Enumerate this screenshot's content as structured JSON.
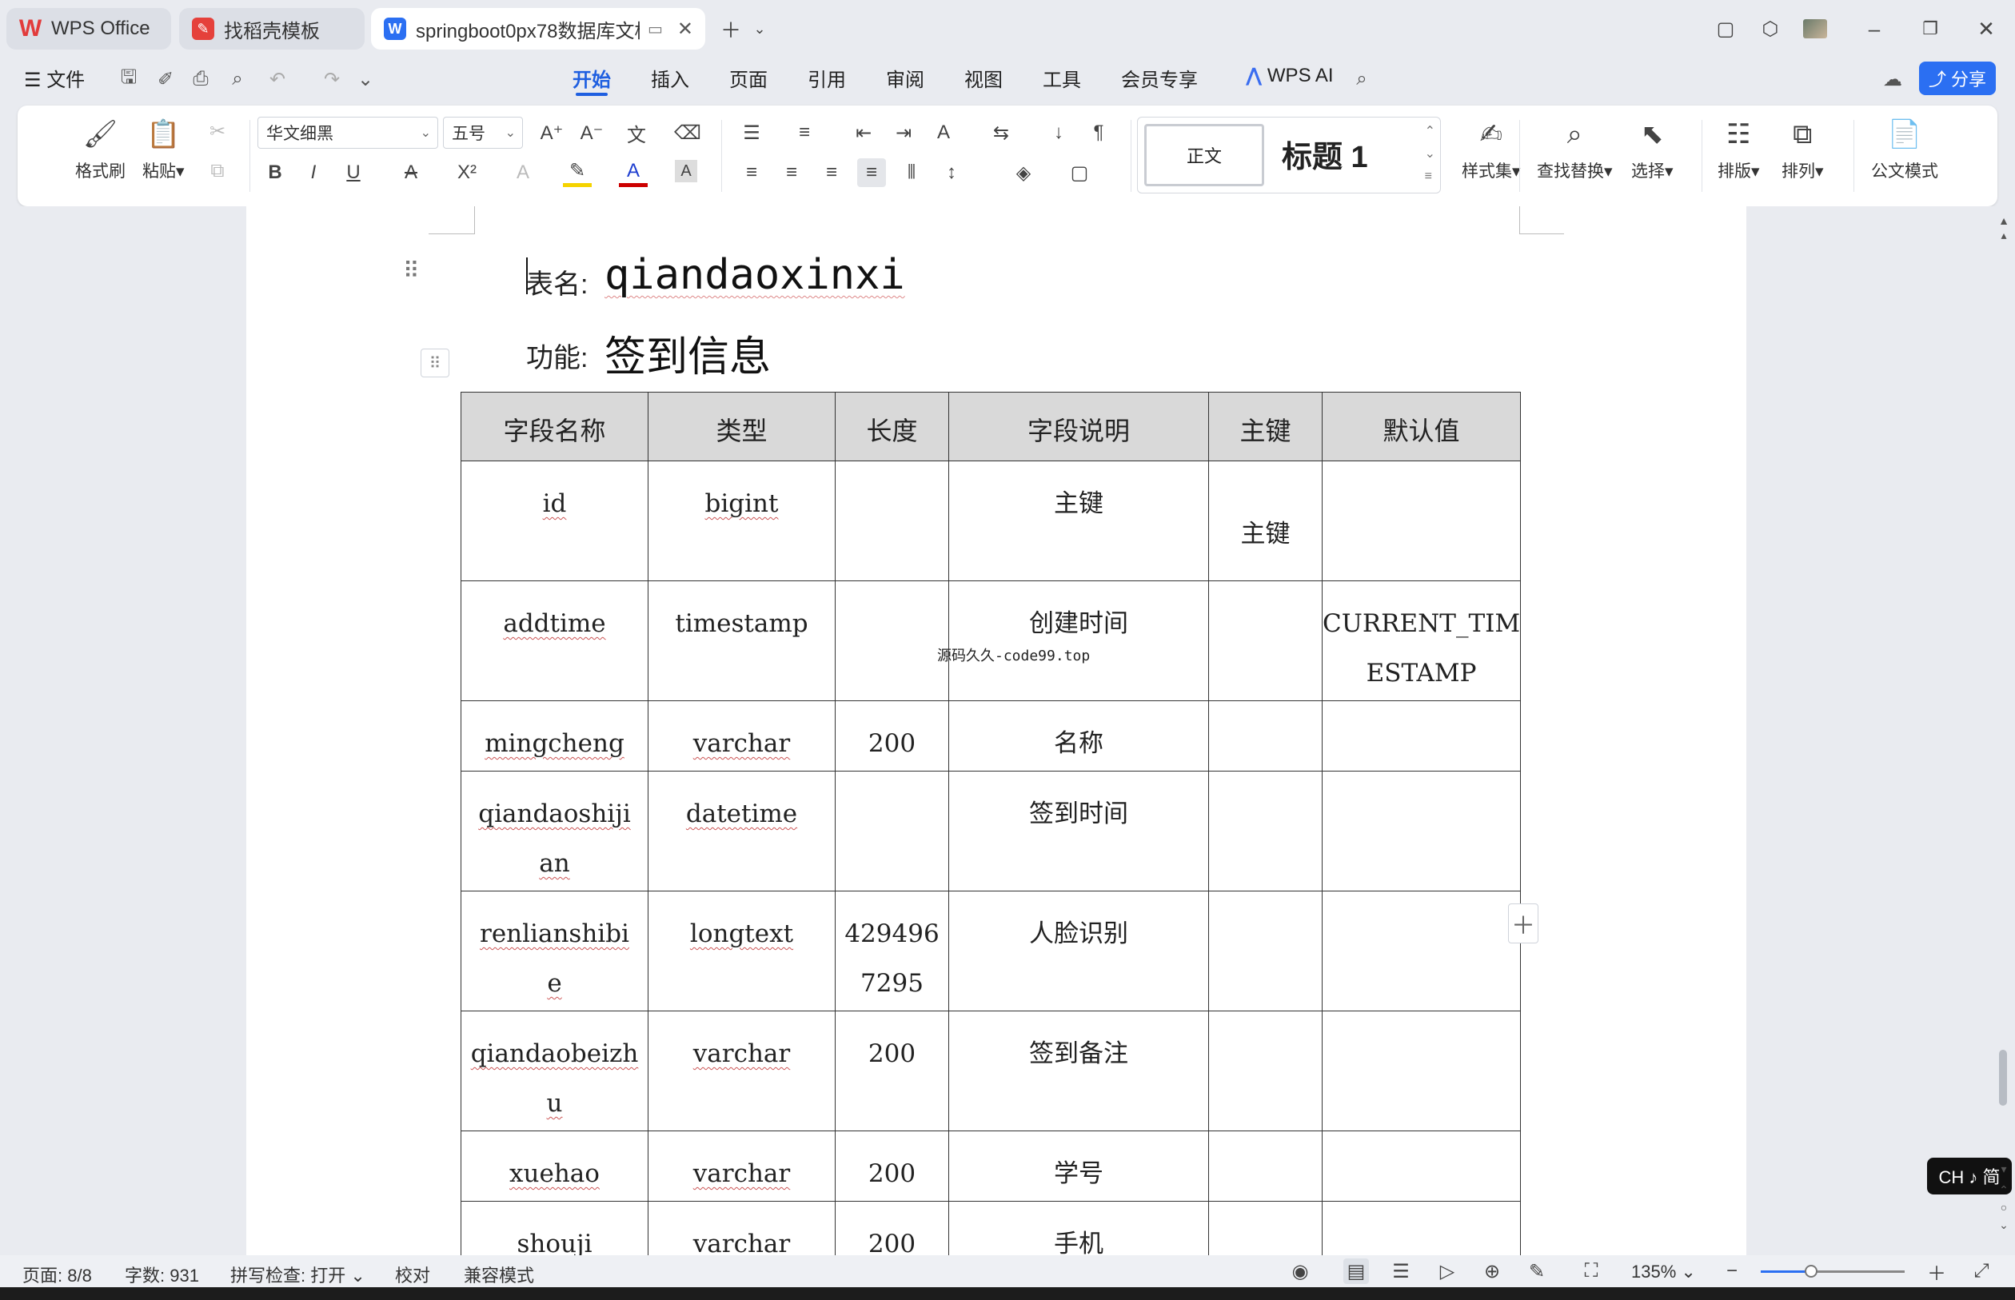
{
  "tabs": [
    {
      "label": "WPS Office",
      "icon": "wps-logo-icon",
      "color": "#e23b3b"
    },
    {
      "label": "找稻壳模板",
      "icon": "docer-icon",
      "color": "#e5413b"
    },
    {
      "label": "springboot0px78数据库文档",
      "icon": "word-doc-icon",
      "color": "#2b6ff2"
    }
  ],
  "menu": {
    "file": "文件",
    "items": [
      "开始",
      "插入",
      "页面",
      "引用",
      "审阅",
      "视图",
      "工具",
      "会员专享"
    ],
    "active_index": 0,
    "wps_ai": "WPS AI",
    "share": "分享"
  },
  "ribbon": {
    "format_painter": "格式刷",
    "paste": "粘贴",
    "font_name": "华文细黑",
    "font_size": "五号",
    "style_normal": "正文",
    "style_heading": "标题 1",
    "style_set": "样式集",
    "find_replace": "查找替换",
    "select": "选择",
    "layout": "排版",
    "arrange": "排列",
    "official_mode": "公文模式"
  },
  "document": {
    "table_label": "表名:",
    "table_name": "qiandaoxinxi",
    "func_label": "功能:",
    "func_name": "签到信息",
    "watermark": "源码久久-code99.top",
    "columns": [
      "字段名称",
      "类型",
      "长度",
      "字段说明",
      "主键",
      "默认值"
    ],
    "rows": [
      {
        "name": [
          "id"
        ],
        "type": "bigint",
        "length": [],
        "desc": "主键",
        "pk": "主键",
        "default": []
      },
      {
        "name": [
          "addtime"
        ],
        "type": "timestamp",
        "length": [],
        "desc": "创建时间",
        "pk": "",
        "default": [
          "CURRENT_TIM",
          "ESTAMP"
        ]
      },
      {
        "name": [
          "mingcheng"
        ],
        "type": "varchar",
        "length": [
          "200"
        ],
        "desc": "名称",
        "pk": "",
        "default": []
      },
      {
        "name": [
          "qiandaoshiji",
          "an"
        ],
        "type": "datetime",
        "length": [],
        "desc": "签到时间",
        "pk": "",
        "default": []
      },
      {
        "name": [
          "renlianshibi",
          "e"
        ],
        "type": "longtext",
        "length": [
          "429496",
          "7295"
        ],
        "desc": "人脸识别",
        "pk": "",
        "default": []
      },
      {
        "name": [
          "qiandaobeizh",
          "u"
        ],
        "type": "varchar",
        "length": [
          "200"
        ],
        "desc": "签到备注",
        "pk": "",
        "default": []
      },
      {
        "name": [
          "xuehao"
        ],
        "type": "varchar",
        "length": [
          "200"
        ],
        "desc": "学号",
        "pk": "",
        "default": []
      },
      {
        "name": [
          "shouji"
        ],
        "type": "varchar",
        "length": [
          "200"
        ],
        "desc": "手机",
        "pk": "",
        "default": []
      }
    ]
  },
  "ime": "CH ♪ 简",
  "status": {
    "page": "页面: 8/8",
    "words": "字数: 931",
    "spell": "拼写检查: 打开",
    "proof": "校对",
    "compat": "兼容模式",
    "zoom": "135%",
    "zoom_fraction": 0.35
  },
  "colors": {
    "accent": "#1f5fe0",
    "share_bg": "#2b6ff2"
  }
}
